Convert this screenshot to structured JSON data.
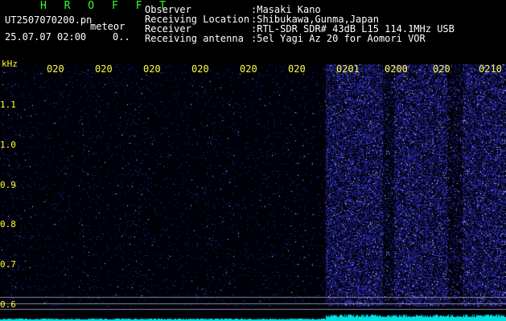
{
  "header": {
    "title": "H R O F F T",
    "filename": "UT2507070200.pn",
    "mode": "meteor",
    "datetime": "25.07.07 02:00",
    "count": "0..",
    "fields": [
      {
        "label": "Observer",
        "value": ":Masaki Kano"
      },
      {
        "label": "Receiving Location",
        "value": ":Shibukawa,Gunma,Japan"
      },
      {
        "label": "Receiver",
        "value": ":RTL-SDR SDR# 43dB L15 114.1MHz USB"
      },
      {
        "label": "Receiving antenna",
        "value": ":5el Yagi Az 20 for Aomori VOR"
      }
    ]
  },
  "spectrogram": {
    "y_unit": "kHz",
    "y_ticks": [
      "1.1",
      "1.0",
      "0.9",
      "0.8",
      "0.7",
      "0.6"
    ],
    "y_tick_values": [
      1.1,
      1.0,
      0.9,
      0.8,
      0.7,
      0.6
    ],
    "x_ticks": [
      "020",
      "020",
      "020",
      "020",
      "020",
      "020",
      "0201",
      "0200",
      "020",
      "0210"
    ],
    "colors": {
      "background": "#000010",
      "noise": "#2a2aff",
      "baseline": "#00e0e0",
      "ticks_text": "#ffff33"
    }
  }
}
